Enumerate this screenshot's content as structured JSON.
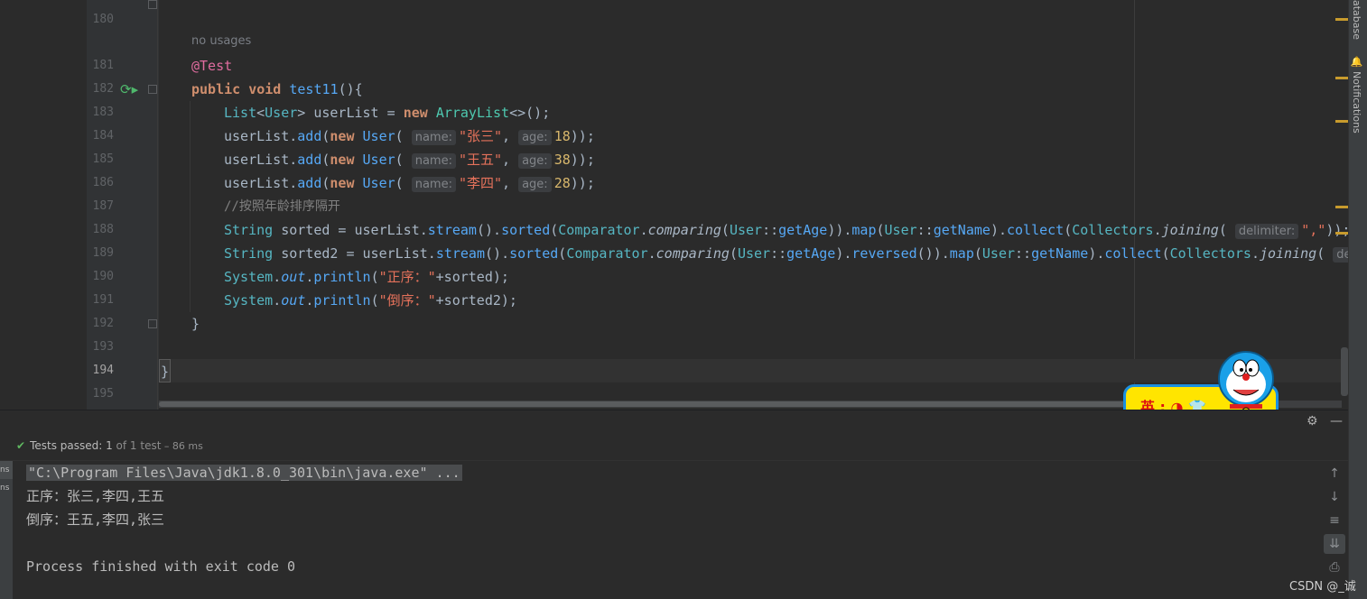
{
  "editor": {
    "inlay_usages": "no usages",
    "line_numbers": [
      "180",
      "181",
      "182",
      "183",
      "184",
      "185",
      "186",
      "187",
      "188",
      "189",
      "190",
      "191",
      "192",
      "193",
      "194",
      "195"
    ],
    "closing_brace": "}",
    "method_closing_brace": "}"
  },
  "code": {
    "l181_annotation": "@Test",
    "l182_public": "public",
    "l182_void": "void",
    "l182_name": "test11",
    "l182_tail": "(){",
    "l183_list": "List",
    "l183_user": "User",
    "l183_mid": "> userList = ",
    "l183_new": "new",
    "l183_arraylist": "ArrayList",
    "l183_tail": "<>();",
    "userList": "userList",
    "dot": ".",
    "add": "add",
    "open": "(",
    "new": "new",
    "User": "User",
    "hint_name": "name:",
    "hint_age": "age:",
    "comma": ", ",
    "close": "));",
    "l184_name": "\"张三\"",
    "l184_age": "18",
    "l185_name": "\"王五\"",
    "l185_age": "38",
    "l186_name": "\"李四\"",
    "l186_age": "28",
    "l187_comment": "//按照年龄排序隔开",
    "String": "String",
    "l188_var": " sorted = ",
    "stream": "stream",
    "paren": "()",
    "sorted": "sorted",
    "Comparator": "Comparator",
    "comparing": "comparing",
    "getAge": "getAge",
    "getName": "getName",
    "map": "map",
    "collect": "collect",
    "Collectors": "Collectors",
    "joining": "joining",
    "hint_delimiter": "delimiter:",
    "l188_delim": "\",\"",
    "l188_tail": "));",
    "l189_var": " sorted2 = ",
    "reversed": "reversed",
    "hint_cut": "de",
    "System": "System",
    "out": "out",
    "println": "println",
    "l190_str": "\"正序：\"",
    "l190_tail": "+sorted);",
    "l191_str": "\"倒序：\"",
    "l191_tail": "+sorted2);"
  },
  "test_panel": {
    "status_prefix": "Tests passed: ",
    "passed": "1",
    "of_text": " of 1 test",
    "duration": " – 86 ms"
  },
  "console": {
    "command": "\"C:\\Program Files\\Java\\jdk1.8.0_301\\bin\\java.exe\" ...",
    "line1": "正序：张三,李四,王五",
    "line2": "倒序：王五,李四,张三",
    "exit": "Process finished with exit code 0"
  },
  "left_tabs": [
    "ns",
    "ns"
  ],
  "side_tools": {
    "database": "atabase",
    "notifications": "Notifications"
  },
  "widget_text": "英 ⁏ ◑ 👕",
  "watermark": "CSDN @_诚",
  "colors": {
    "background": "#2b2b2b",
    "keyword": "#cf8e6d",
    "string": "#e5725b",
    "method": "#56a8f5",
    "success": "#5fb760"
  }
}
